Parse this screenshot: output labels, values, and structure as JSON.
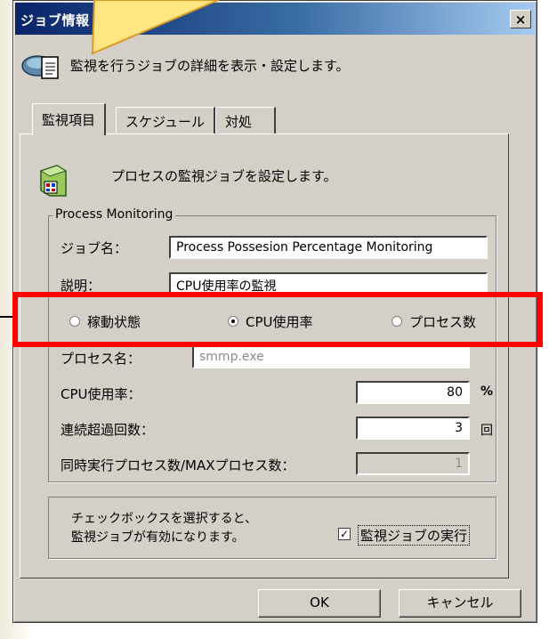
{
  "window": {
    "title": "ジョブ情報",
    "close_label": "×"
  },
  "header": {
    "description": "監視を行うジョブの詳細を表示・設定します。"
  },
  "tabs": [
    {
      "label": "監視項目",
      "active": true
    },
    {
      "label": "スケジュール",
      "active": false
    },
    {
      "label": "対処",
      "active": false
    }
  ],
  "panel": {
    "description": "プロセスの監視ジョブを設定します。",
    "group_title": "Process Monitoring",
    "job_name_label": "ジョブ名：",
    "job_name_value": "Process Possesion Percentage Monitoring",
    "desc_label": "説明：",
    "desc_value": "CPU使用率の監視",
    "radios": [
      {
        "label": "稼動状態",
        "checked": false
      },
      {
        "label": "CPU使用率",
        "checked": true
      },
      {
        "label": "プロセス数",
        "checked": false
      }
    ],
    "process_name_label": "プロセス名：",
    "process_name_value": "smmp.exe",
    "cpu_label": "CPU使用率：",
    "cpu_value": "80",
    "cpu_unit": "%",
    "overflow_label": "連続超過回数：",
    "overflow_value": "3",
    "overflow_unit": "回",
    "proc_count_label": "同時実行プロセス数/MAXプロセス数：",
    "proc_count_value": "1",
    "check_note_line1": "チェックボックスを選択すると、",
    "check_note_line2": "監視ジョブが有効になります。",
    "run_checkbox_label": "監視ジョブの実行",
    "run_checked": true
  },
  "buttons": {
    "ok": "OK",
    "cancel": "キャンセル"
  },
  "colors": {
    "highlight": "#ff0000",
    "callout": "#ffe680",
    "title_bar": "#0a246a"
  }
}
